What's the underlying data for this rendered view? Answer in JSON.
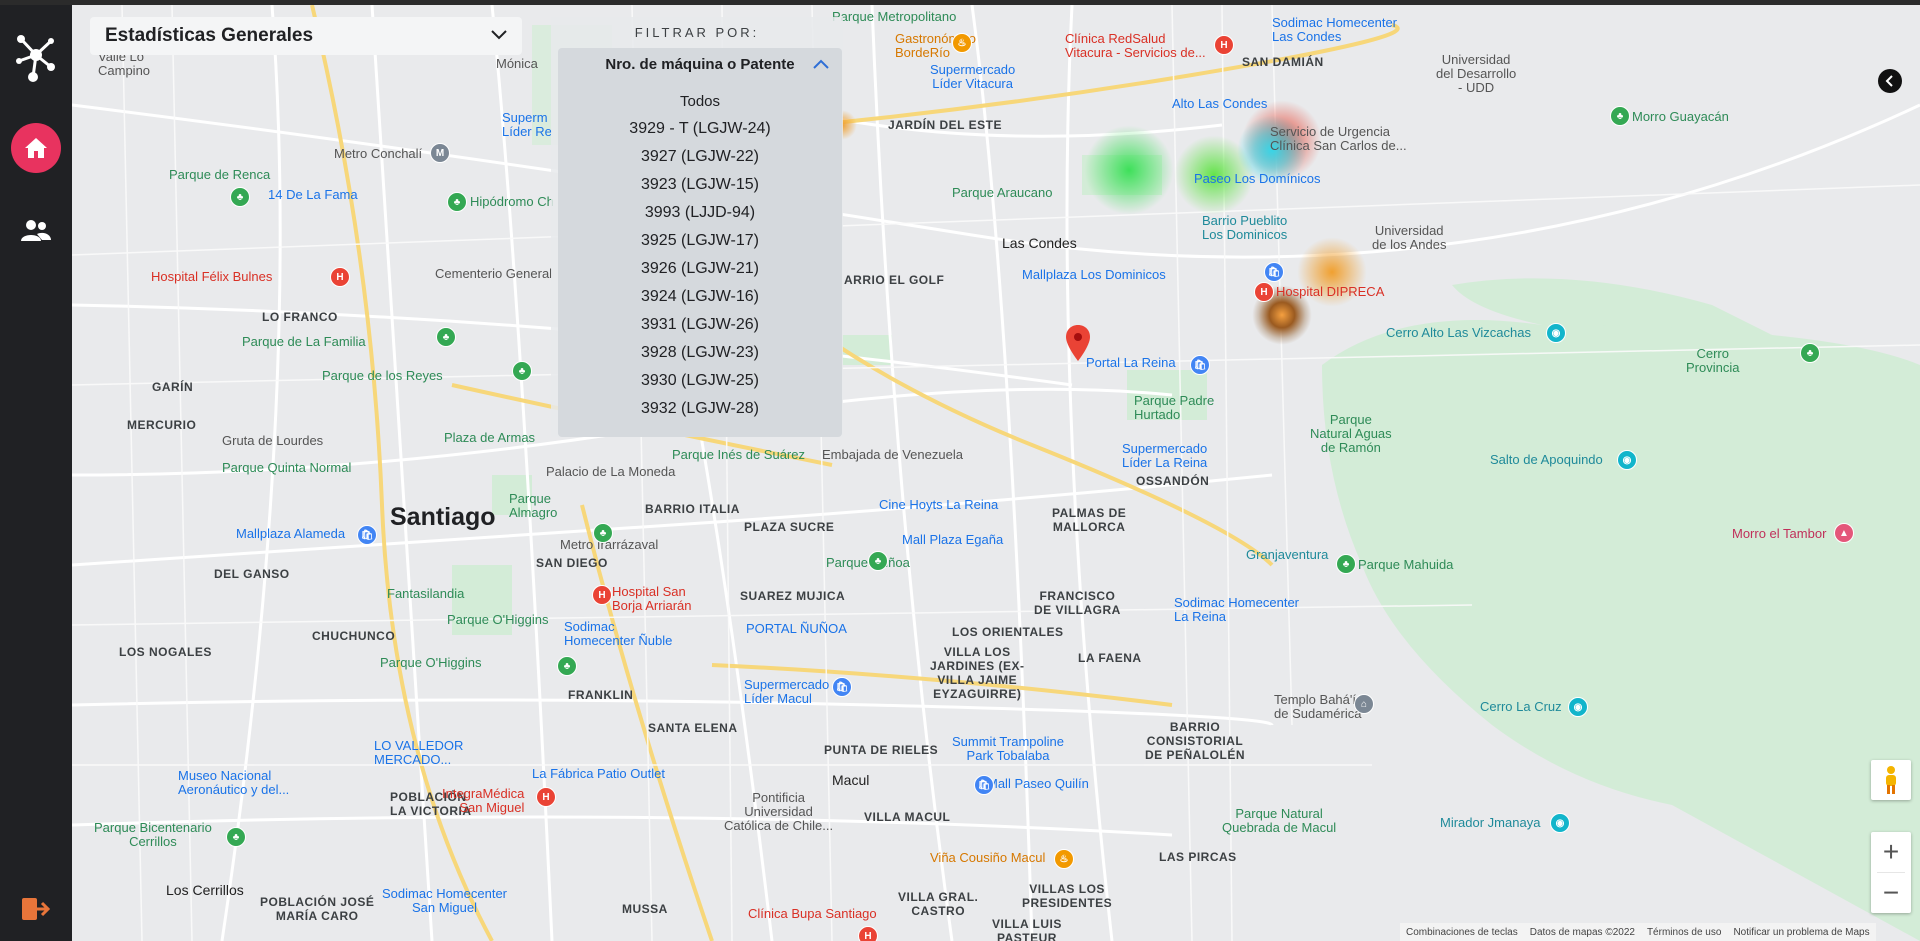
{
  "stats_select": {
    "label": "Estadísticas Generales"
  },
  "filter": {
    "title": "FILTRAR POR:",
    "selected": "Nro. de máquina o Patente",
    "options": [
      "Todos",
      "3929 - T (LGJW-24)",
      "3927 (LGJW-22)",
      "3923 (LGJW-15)",
      "3993 (LJJD-94)",
      "3925 (LGJW-17)",
      "3926 (LGJW-21)",
      "3924 (LGJW-16)",
      "3931 (LGJW-26)",
      "3928 (LGJW-23)",
      "3930 (LGJW-25)",
      "3932 (LGJW-28)"
    ]
  },
  "map": {
    "city_label": "Santiago",
    "labels": {
      "valle_lo_campino": "Valle Lo\nCampino",
      "metro_conchali": "Metro Conchalí",
      "parque_renca": "Parque de Renca",
      "fontana": "14 De La Fama",
      "hipodromo": "Hipódromo Ch",
      "hospital_felix": "Hospital Félix Bulnes",
      "cementerio": "Cementerio General",
      "lo_franco": "LO FRANCO",
      "parque_familia": "Parque de La Familia",
      "parque_reyes": "Parque de los Reyes",
      "garin": "GARÍN",
      "mercurio": "MERCURIO",
      "gruta_lourdes": "Gruta de Lourdes",
      "plaza_armas": "Plaza de Armas",
      "parque_quinta": "Parque Quinta Normal",
      "palacio_moneda": "Palacio de La Moneda",
      "parque_ines": "Parque Inés de Suárez",
      "embajada": "Embajada de Venezuela",
      "parque_almagro": "Parque\nAlmagro",
      "barrio_italia": "BARRIO ITALIA",
      "plaza_sucre": "PLAZA SUCRE",
      "mallplaza_alameda": "Mallplaza Alameda",
      "metro_irarrazaval": "Metro Irarrázaval",
      "san_diego": "SAN DIEGO",
      "cine_hoyts": "Cine Hoyts La Reina",
      "mall_plaza_egana": "Mall Plaza Egaña",
      "parque_nunoa": "Parque Ñuñoa",
      "villa_olimpica": "DEL GANSO",
      "fantasilandia": "Fantasilandia",
      "hospital_borja": "Hospital San\nBorja Arriarán",
      "suarez_mujica": "SUAREZ MUJICA",
      "parque_ohiggins": "Parque O'Higgins",
      "sodimac_nuble": "Sodimac\nHomecenter Ñuble",
      "portal_nunoa": "PORTAL ÑUÑOA",
      "chuchunco": "CHUCHUNCO",
      "los_nogales": "LOS NOGALES",
      "parque_ohiggins2": "Parque O'Higgins",
      "franklin": "FRANKLIN",
      "supermercado_macul": "Supermercado\nLíder Macul",
      "los_orientales": "LOS ORIENTALES",
      "villa_jaime": "VILLA LOS\nJARDINES (EX-\nVILLA JAIME\nEYZAGUIRRE)",
      "la_faena": "LA FAENA",
      "santa_elena": "SANTA ELENA",
      "punta_rieles": "PUNTA DE RIELES",
      "summit": "Summit Trampoline\nPark Tobalaba",
      "mall_paseo_quilin": "Mall Paseo Quilín",
      "barrio_consistorial": "BARRIO\nCONSISTORIAL\nDE PEÑALOLÉN",
      "la_fabrica": "La Fábrica Patio Outlet",
      "macul": "Macul",
      "lo_valledor": "LO VALLEDOR\nMERCADO...",
      "museo_aero": "Museo Nacional\nAeronáutico y del...",
      "poblacion_victoria": "POBLACIÓN\nLA VICTORIA",
      "integramedica": "IntegraMédica\nSan Miguel",
      "pontificia": "Pontificia\nUniversidad\nCatólica de Chile...",
      "villa_macul": "VILLA MACUL",
      "parque_bicentenario": "Parque Bicentenario\nCerrillos",
      "los_cerrillos": "Los Cerrillos",
      "poblacion_jose": "POBLACIÓN JOSÉ\nMARÍA CARO",
      "sodimac_san_miguel": "Sodimac Homecenter\nSan Miguel",
      "mussa": "MUSSA",
      "clinica_bupa": "Clínica Bupa Santiago",
      "villa_grial": "VILLA GRAL.\nCASTRO",
      "villa_los_presidentes": "VILLAS LOS\nPRESIDENTES",
      "villa_luis": "VILLA LUIS\nPASTEUR",
      "vina_cousino": "Viña Cousiño Macul",
      "las_pircas": "LAS PIRCAS",
      "parque_natural_quebrada": "Parque Natural\nQuebrada de Macul",
      "mirador": "Mirador Jmanaya",
      "cerro_la_cruz": "Cerro La Cruz",
      "templo_bahai": "Templo Bahá'í\nde Sudamérica",
      "sodimac_la_reina": "Sodimac Homecenter\nLa Reina",
      "granjaventura": "Granjaventura",
      "parque_mahuida": "Parque Mahuida",
      "francisco_villagra": "FRANCISCO\nDE VILLAGRA",
      "palmas_mallorca": "PALMAS DE\nMALLORCA",
      "ossandon": "OSSANDÓN",
      "supermercado_reina": "Supermercado\nLíder La Reina",
      "parque_padre": "Parque Padre\nHurtado",
      "portal_la_reina": "Portal La Reina",
      "parque_aguas": "Parque\nNatural Aguas\nde Ramón",
      "salto_apoquindo": "Salto de Apoquindo",
      "morro_tambor": "Morro el Tambor",
      "cerro_alto": "Cerro Alto Las Vizcachas",
      "cerro_provincia": "Cerro\nProvincia",
      "hospital_dipreca": "Hospital DIPRECA",
      "mallplaza_dominicos": "Mallplaza Los Dominicos",
      "las_condes": "Las Condes",
      "barrio_el_golf": "ARRIO EL GOLF",
      "parque_araucano": "Parque Araucano",
      "barrio_pueblito": "Barrio Pueblito\nLos Dominicos",
      "paseo_dominicos": "Paseo Los Domínicos",
      "universidad_andes": "Universidad\nde los Andes",
      "servicio_urgencia": "Servicio de Urgencia\nClínica San Carlos de...",
      "alto_las_condes": "Alto Las Condes",
      "jardin_este": "JARDÍN DEL ESTE",
      "supermercado_vitacura": "Supermercado\nLíder Vitacura",
      "clinica_redsalud": "Clínica RedSalud\nVitacura - Servicios de...",
      "sodimac_las_condes": "Sodimac Homecenter\nLas Condes",
      "san_damian": "SAN DAMIÁN",
      "universidad_desarrollo": "Universidad\ndel Desarrollo\n- UDD",
      "morro_guayacan": "Morro Guayacán",
      "borde_rio": "Gastronómico\nBordeRío",
      "parque_metropolitano": "Parque Metropolitano",
      "supermercado_lider_rec": "Superm\nLíder Re",
      "monica": "Mónica"
    }
  },
  "attribution": {
    "shortcuts": "Combinaciones de teclas",
    "data": "Datos de mapas ©2022",
    "terms": "Términos de uso",
    "report": "Notificar un problema de Maps"
  }
}
